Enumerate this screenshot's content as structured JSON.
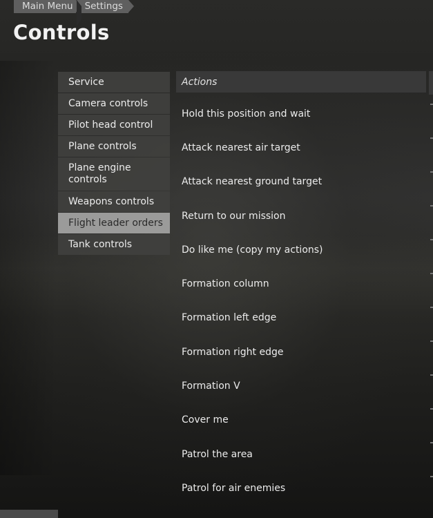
{
  "breadcrumb": [
    "Main Menu",
    "Settings"
  ],
  "page_title": "Controls",
  "sidebar": {
    "items": [
      {
        "label": "Service"
      },
      {
        "label": "Camera controls"
      },
      {
        "label": "Pilot head control"
      },
      {
        "label": "Plane controls"
      },
      {
        "label": "Plane engine controls"
      },
      {
        "label": "Weapons controls"
      },
      {
        "label": "Flight leader orders",
        "selected": true
      },
      {
        "label": "Tank controls"
      }
    ]
  },
  "actions": {
    "header": "Actions",
    "items": [
      "Hold this position and wait",
      "Attack nearest air target",
      "Attack nearest ground target",
      "Return to our mission",
      "Do like me (copy my actions)",
      "Formation column",
      "Formation left edge",
      "Formation right edge",
      "Formation V",
      "Cover me",
      "Patrol the area",
      "Patrol for air enemies"
    ]
  },
  "colors": {
    "sidebar_bg": "#40403e",
    "sidebar_selected_bg": "#9b9b9a",
    "breadcrumb_bg": "#5f5f5f",
    "header_bg": "#3a3a3a"
  }
}
